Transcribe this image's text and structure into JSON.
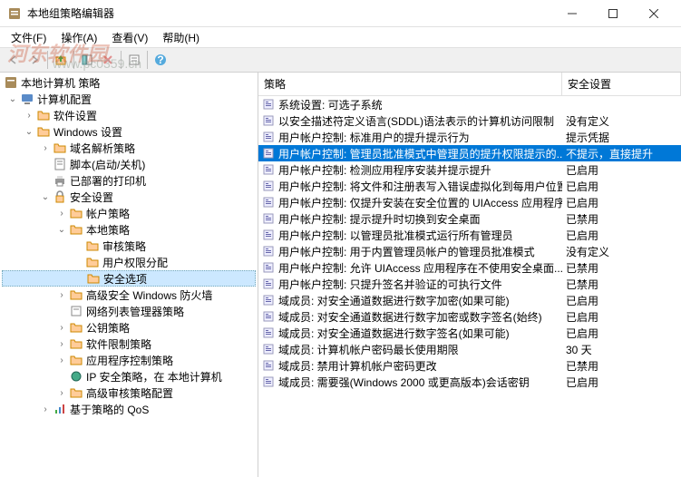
{
  "window": {
    "title": "本地组策略编辑器"
  },
  "menu": {
    "file": "文件(F)",
    "action": "操作(A)",
    "view": "查看(V)",
    "help": "帮助(H)"
  },
  "watermark": {
    "text1": "河东软件园",
    "text2": "www.pc0359.cn"
  },
  "tree": {
    "root": "本地计算机 策略",
    "computer": "计算机配置",
    "software": "软件设置",
    "windows": "Windows 设置",
    "dns": "域名解析策略",
    "script": "脚本(启动/关机)",
    "printer": "已部署的打印机",
    "security": "安全设置",
    "account": "帐户策略",
    "local": "本地策略",
    "audit": "审核策略",
    "rights": "用户权限分配",
    "secopts": "安全选项",
    "firewall": "高级安全 Windows 防火墙",
    "netlist": "网络列表管理器策略",
    "pubkey": "公钥策略",
    "restrict": "软件限制策略",
    "appctl": "应用程序控制策略",
    "ipsec": "IP 安全策略，在 本地计算机",
    "advaudit": "高级审核策略配置",
    "qos": "基于策略的 QoS"
  },
  "list": {
    "header1": "策略",
    "header2": "安全设置",
    "rows": [
      {
        "name": "系统设置: 可选子系统",
        "value": ""
      },
      {
        "name": "以安全描述符定义语言(SDDL)语法表示的计算机访问限制",
        "value": "没有定义"
      },
      {
        "name": "用户帐户控制: 标准用户的提升提示行为",
        "value": "提示凭据"
      },
      {
        "name": "用户帐户控制: 管理员批准模式中管理员的提升权限提示的...",
        "value": "不提示，直接提升",
        "selected": true
      },
      {
        "name": "用户帐户控制: 检测应用程序安装并提示提升",
        "value": "已启用"
      },
      {
        "name": "用户帐户控制: 将文件和注册表写入错误虚拟化到每用户位置",
        "value": "已启用"
      },
      {
        "name": "用户帐户控制: 仅提升安装在安全位置的 UIAccess 应用程序",
        "value": "已启用"
      },
      {
        "name": "用户帐户控制: 提示提升时切换到安全桌面",
        "value": "已禁用"
      },
      {
        "name": "用户帐户控制: 以管理员批准模式运行所有管理员",
        "value": "已启用"
      },
      {
        "name": "用户帐户控制: 用于内置管理员帐户的管理员批准模式",
        "value": "没有定义"
      },
      {
        "name": "用户帐户控制: 允许 UIAccess 应用程序在不使用安全桌面...",
        "value": "已禁用"
      },
      {
        "name": "用户帐户控制: 只提升签名并验证的可执行文件",
        "value": "已禁用"
      },
      {
        "name": "域成员: 对安全通道数据进行数字加密(如果可能)",
        "value": "已启用"
      },
      {
        "name": "域成员: 对安全通道数据进行数字加密或数字签名(始终)",
        "value": "已启用"
      },
      {
        "name": "域成员: 对安全通道数据进行数字签名(如果可能)",
        "value": "已启用"
      },
      {
        "name": "域成员: 计算机帐户密码最长使用期限",
        "value": "30 天"
      },
      {
        "name": "域成员: 禁用计算机帐户密码更改",
        "value": "已禁用"
      },
      {
        "name": "域成员: 需要强(Windows 2000 或更高版本)会话密钥",
        "value": "已启用"
      }
    ]
  }
}
